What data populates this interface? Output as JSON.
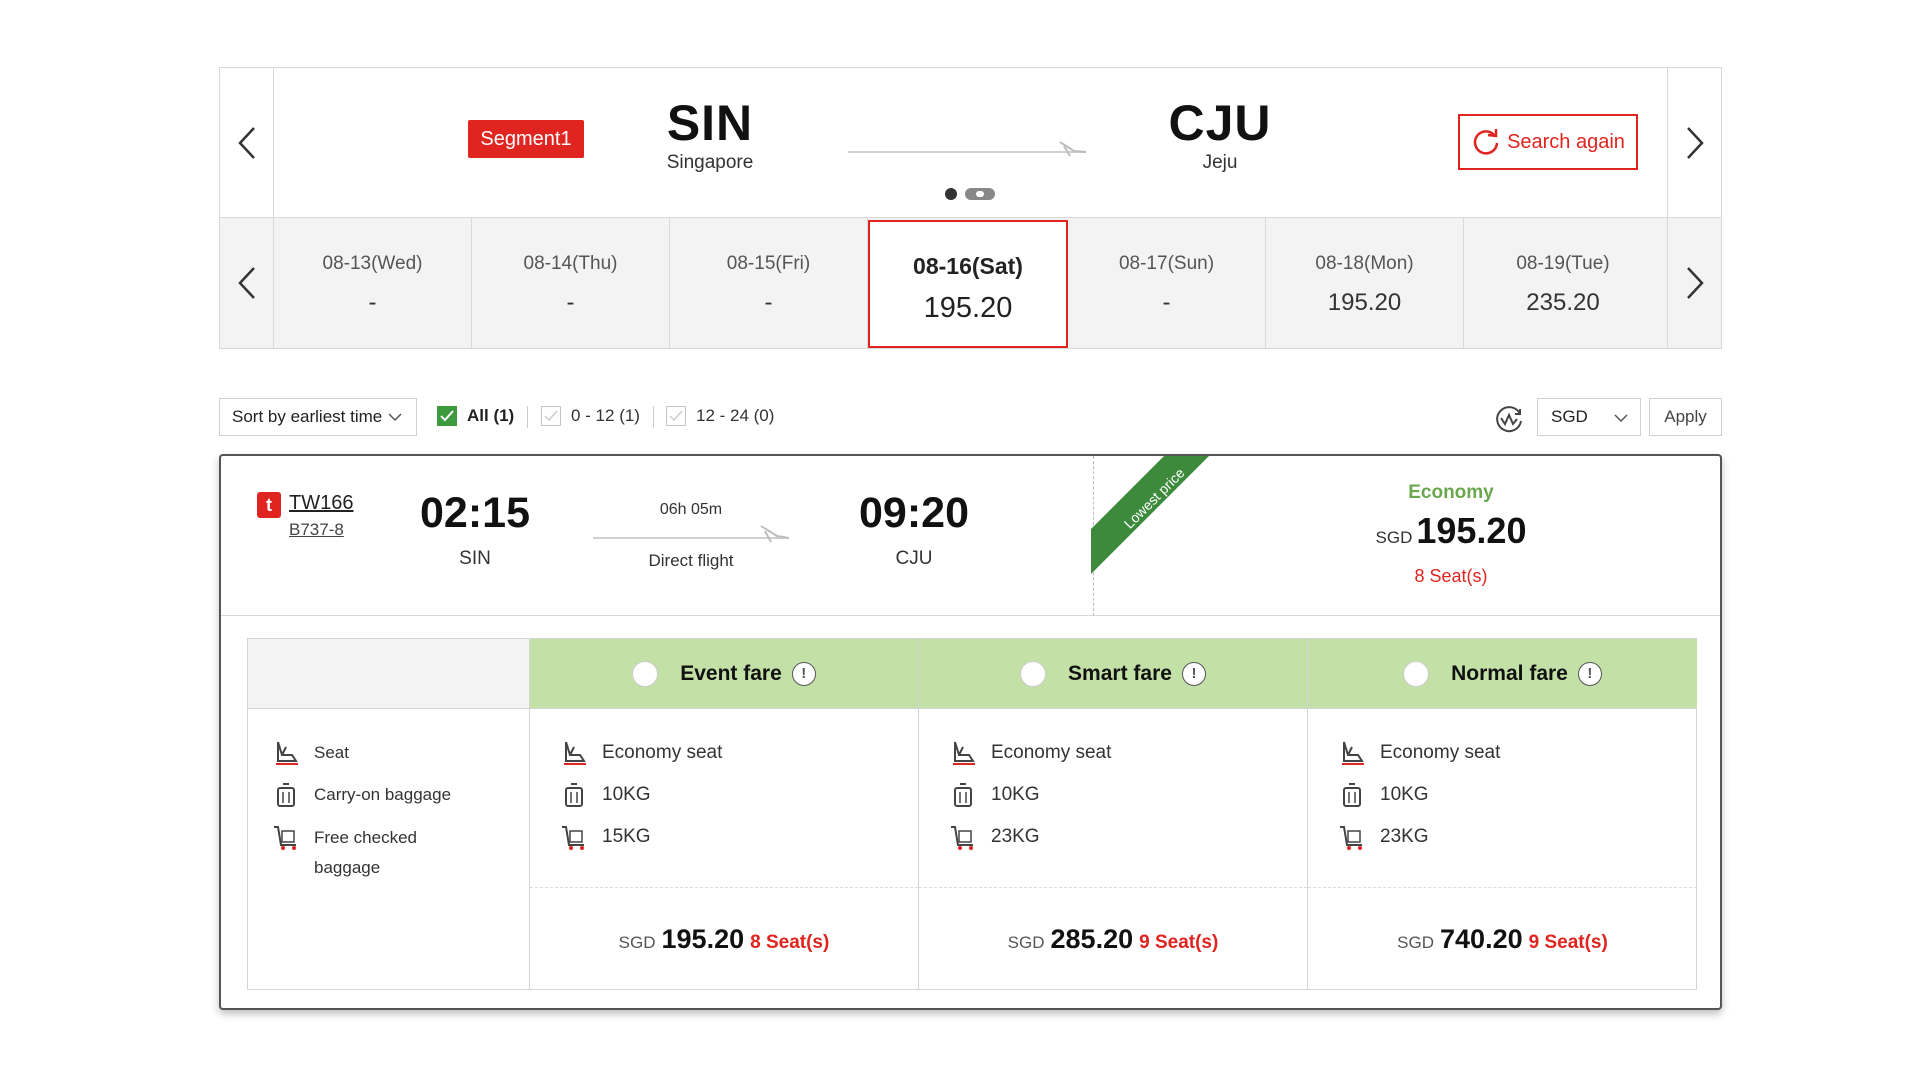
{
  "route": {
    "segment_label": "Segment1",
    "from_code": "SIN",
    "from_city": "Singapore",
    "to_code": "CJU",
    "to_city": "Jeju",
    "search_again_label": "Search again"
  },
  "dates": [
    {
      "date": "08-13(Wed)",
      "price": "-"
    },
    {
      "date": "08-14(Thu)",
      "price": "-"
    },
    {
      "date": "08-15(Fri)",
      "price": "-"
    },
    {
      "date": "08-16(Sat)",
      "price": "195.20",
      "selected": true
    },
    {
      "date": "08-17(Sun)",
      "price": "-"
    },
    {
      "date": "08-18(Mon)",
      "price": "195.20"
    },
    {
      "date": "08-19(Tue)",
      "price": "235.20"
    }
  ],
  "filters": {
    "sort_label": "Sort by earliest time",
    "all_label": "All (1)",
    "range1_label": "0 - 12 (1)",
    "range2_label": "12 - 24 (0)",
    "currency": "SGD",
    "apply_label": "Apply"
  },
  "flight": {
    "flight_no": "TW166",
    "aircraft": "B737-8",
    "dep_time": "02:15",
    "dep_code": "SIN",
    "arr_time": "09:20",
    "arr_code": "CJU",
    "duration": "06h 05m",
    "direct_label": "Direct flight",
    "ribbon_label": "Lowest price",
    "class_label": "Economy",
    "currency": "SGD",
    "price": "195.20",
    "seats": "8 Seat(s)"
  },
  "fare_table": {
    "labels": {
      "seat": "Seat",
      "carry": "Carry-on baggage",
      "checked": "Free checked baggage"
    },
    "fares": [
      {
        "name": "Event fare",
        "seat": "Economy seat",
        "carry": "10KG",
        "checked": "15KG",
        "currency": "SGD",
        "price": "195.20",
        "seats": "8 Seat(s)"
      },
      {
        "name": "Smart fare",
        "seat": "Economy seat",
        "carry": "10KG",
        "checked": "23KG",
        "currency": "SGD",
        "price": "285.20",
        "seats": "9 Seat(s)"
      },
      {
        "name": "Normal fare",
        "seat": "Economy seat",
        "carry": "10KG",
        "checked": "23KG",
        "currency": "SGD",
        "price": "740.20",
        "seats": "9 Seat(s)"
      }
    ]
  },
  "colors": {
    "accent_red": "#e0241f",
    "fare_header_green": "#c3e0a7",
    "economy_green": "#6aa84f",
    "checkbox_green": "#3d9a3d"
  }
}
